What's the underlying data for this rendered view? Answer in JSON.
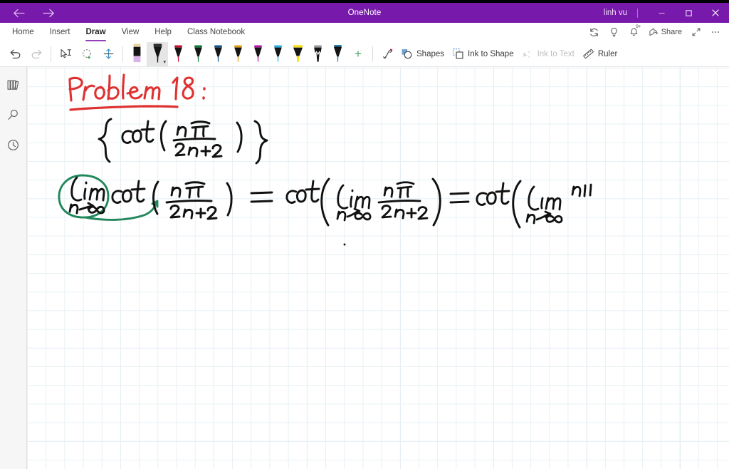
{
  "window": {
    "app_title": "OneNote",
    "user": "linh vu",
    "back_icon": "back-arrow-icon",
    "forward_icon": "forward-arrow-icon",
    "minimize_label": "–",
    "restore_label": "❐",
    "close_label": "✕",
    "accent_color": "#7719aa"
  },
  "ribbon": {
    "tabs": [
      {
        "label": "Home",
        "active": false
      },
      {
        "label": "Insert",
        "active": false
      },
      {
        "label": "Draw",
        "active": true
      },
      {
        "label": "View",
        "active": false
      },
      {
        "label": "Help",
        "active": false
      },
      {
        "label": "Class Notebook",
        "active": false
      }
    ],
    "right_actions": [
      {
        "label": "",
        "icon": "sync-icon",
        "name": "sync-button"
      },
      {
        "label": "",
        "icon": "lightbulb-icon",
        "name": "tell-me-button"
      },
      {
        "label": "",
        "icon": "bell-icon",
        "name": "notifications-button",
        "badge": "9+"
      },
      {
        "label": "Share",
        "icon": "share-icon",
        "name": "share-button"
      },
      {
        "label": "",
        "icon": "expand-icon",
        "name": "full-page-view-button"
      },
      {
        "label": "",
        "icon": "ellipsis-icon",
        "name": "more-options-button"
      }
    ],
    "tools": {
      "undo_label": "Undo",
      "redo_label": "Redo",
      "redo_disabled": true,
      "select_label": "Ink to Text Select",
      "lasso_label": "Lasso Select",
      "insert_space_label": "Insert Space",
      "add_pen_label": "+",
      "shapes_label": "Shapes",
      "ink_to_shape_label": "Ink to Shape",
      "ink_to_text_label": "Ink to Text",
      "ink_to_text_disabled": true,
      "ruler_label": "Ruler"
    },
    "pens": [
      {
        "name": "highlighter-lavender",
        "body": "#0d0d0d",
        "tip": "#d9b3e6",
        "ferrule": "#e8d3a0",
        "selected": false,
        "wide": false
      },
      {
        "name": "pen-black",
        "body": "#0d0d0d",
        "tip": "#1a1a1a",
        "ferrule": "#2b2b2b",
        "selected": true,
        "wide": false
      },
      {
        "name": "pen-red",
        "body": "#0d0d0d",
        "tip": "#c8102e",
        "ferrule": "#c8102e",
        "selected": false,
        "wide": false
      },
      {
        "name": "pen-green",
        "body": "#0d0d0d",
        "tip": "#0e7a3c",
        "ferrule": "#0e7a3c",
        "selected": false,
        "wide": false
      },
      {
        "name": "pen-blue",
        "body": "#0d0d0d",
        "tip": "#14558f",
        "ferrule": "#14558f",
        "selected": false,
        "wide": false
      },
      {
        "name": "pen-gold",
        "body": "#0d0d0d",
        "tip": "#e0a011",
        "ferrule": "#e0a011",
        "selected": false,
        "wide": false
      },
      {
        "name": "pen-magenta",
        "body": "#0d0d0d",
        "tip": "#b5199e",
        "ferrule": "#b5199e",
        "selected": false,
        "wide": false
      },
      {
        "name": "pen-cyan",
        "body": "#0d0d0d",
        "tip": "#29aee0",
        "ferrule": "#29aee0",
        "selected": false,
        "wide": false
      },
      {
        "name": "highlighter-yellow",
        "body": "#0d0d0d",
        "tip": "#f7e01c",
        "ferrule": "#f7e01c",
        "selected": false,
        "wide": true
      },
      {
        "name": "pencil-gray",
        "body": "#0d0d0d",
        "tip": "#9a9a9a",
        "ferrule": "#9a9a9a",
        "selected": false,
        "wide": false
      },
      {
        "name": "pen-teal",
        "body": "#0d0d0d",
        "tip": "#1f7fa8",
        "ferrule": "#1f7fa8",
        "selected": false,
        "wide": false
      }
    ]
  },
  "sidebar": {
    "items": [
      {
        "name": "notebooks-button",
        "icon": "notebooks-icon",
        "label": "Notebooks"
      },
      {
        "name": "search-button",
        "icon": "search-icon",
        "label": "Search"
      },
      {
        "name": "recent-notes-button",
        "icon": "clock-icon",
        "label": "Recent Notes"
      }
    ]
  },
  "page": {
    "grid_style": "graph-paper",
    "ink_notes": [
      {
        "name": "problem-heading",
        "color": "#e03131",
        "text": "Problem 18 :",
        "underlined": true
      },
      {
        "name": "sequence-expression",
        "color": "#101010",
        "text": "{ cot ( nπ / 2n+2 ) }"
      },
      {
        "name": "limit-annotation-circle",
        "color": "#22885c",
        "text": "lim n→∞ (circled with arrow to denominator)"
      },
      {
        "name": "limit-equation",
        "color": "#101010",
        "text": "lim n→∞ cot ( nπ / 2n+2 ) = cot ( lim n→∞  nπ / 2n+2 ) = cot ( lim n→∞  nπ"
      }
    ]
  }
}
